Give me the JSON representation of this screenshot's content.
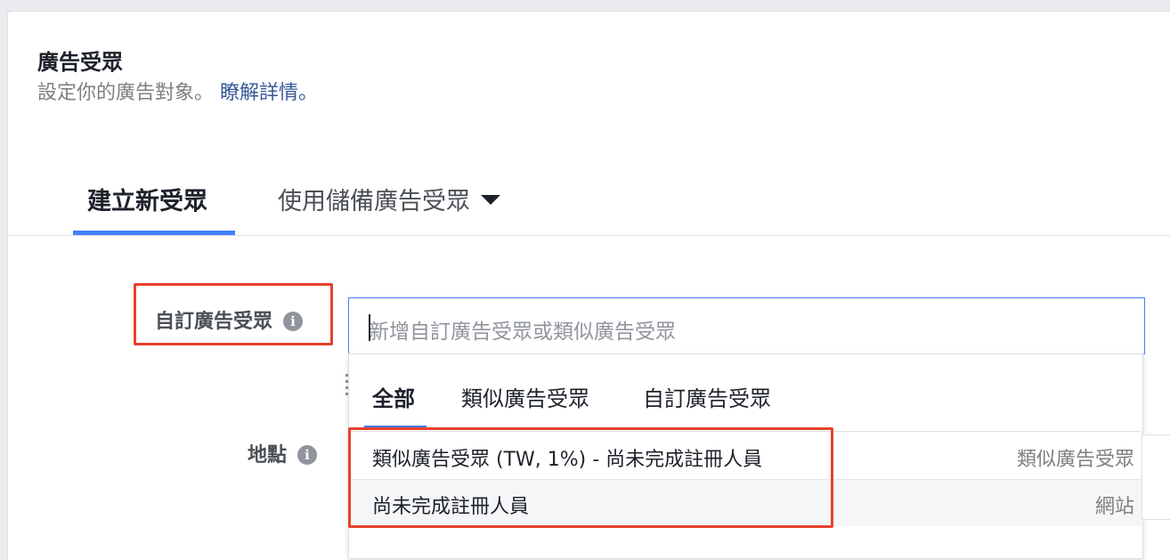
{
  "header": {
    "title": "廣告受眾",
    "subtitle": "設定你的廣告對象。",
    "learn_more": "瞭解詳情。"
  },
  "tabs": {
    "create_new": "建立新受眾",
    "use_saved": "使用儲備廣告受眾"
  },
  "fields": {
    "custom_audience_label": "自訂廣告受眾",
    "location_label": "地點",
    "info_glyph": "i"
  },
  "search": {
    "placeholder": "新增自訂廣告受眾或類似廣告受眾"
  },
  "dropdown": {
    "tabs": [
      "全部",
      "類似廣告受眾",
      "自訂廣告受眾"
    ],
    "results": [
      {
        "name": "類似廣告受眾 (TW, 1%) - 尚未完成註冊人員",
        "type": "類似廣告受眾"
      },
      {
        "name": "尚未完成註冊人員",
        "type": "網站"
      }
    ]
  },
  "colors": {
    "accent": "#4080ff",
    "link": "#365899",
    "highlight_box": "#e8412c"
  }
}
